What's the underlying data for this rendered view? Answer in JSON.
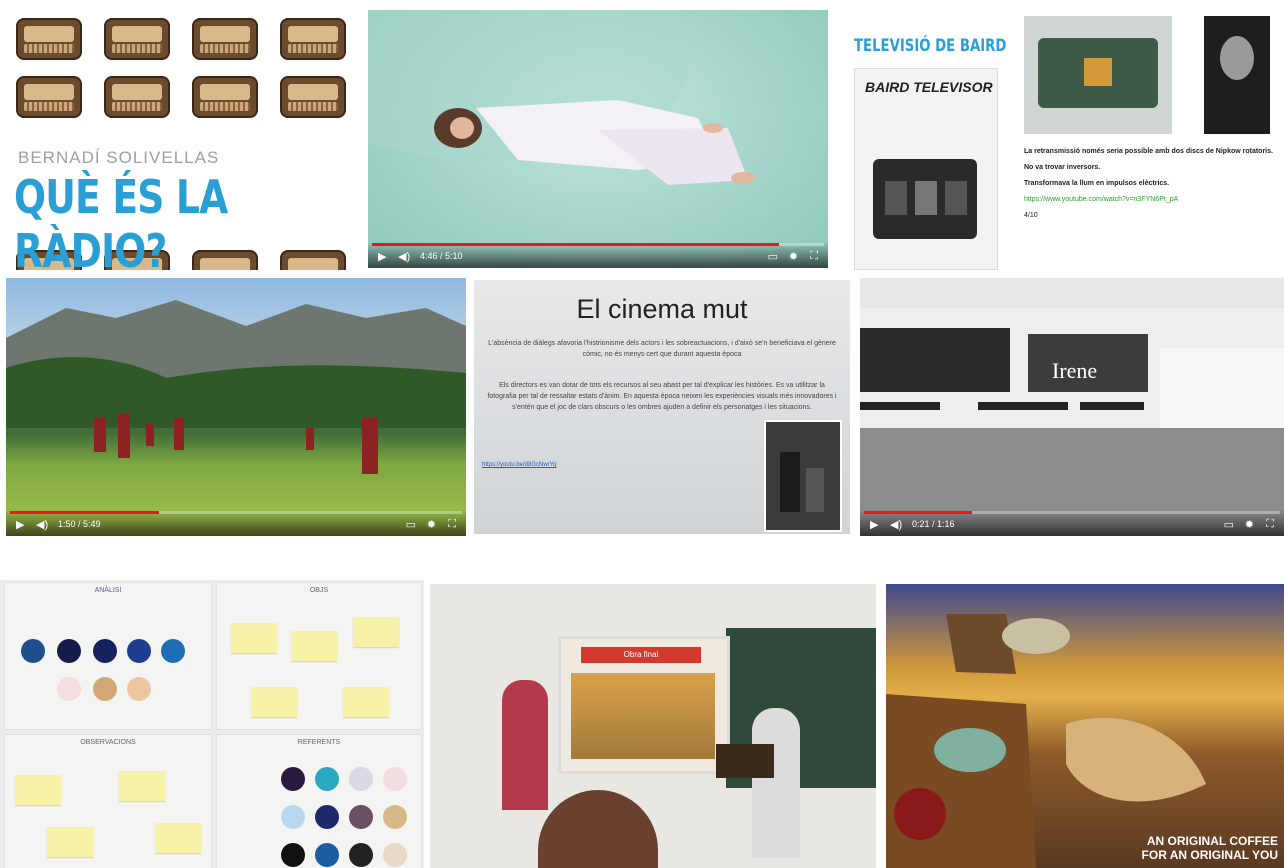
{
  "radio_slide": {
    "author": "BERNADÍ SOLIVELLAS",
    "title": "QUÈ ÉS LA RÀDIO?"
  },
  "video_floating": {
    "time": "4:46 / 5:10",
    "progress": 0.9
  },
  "baird_slide": {
    "title": "TELEVISIÓ DE BAIRD",
    "ad_title": "BAIRD TELEVISOR",
    "line1": "La retransmissió només seria possible amb dos discs de Nipkow rotatoris.",
    "line2": "No va trovar inversors.",
    "line3": "Transformava la llum en impulsos elèctrics.",
    "link": "https://www.youtube.com/watch?v=n3FYN6Pt_pA",
    "number": "4/10"
  },
  "video_meadow": {
    "time": "1:50 / 5:49",
    "progress": 0.33
  },
  "cinema_slide": {
    "title": "El cinema mut",
    "p1": "L'absència de diàlegs afavoria l'histrionisme dels actors i les sobreactuacions, i d'això se'n beneficiava el gènere còmic, no és menys cert que durant aquesta època",
    "p2": "Els directors es van dotar de tots els recursos al seu abast per tal d'explicar les històries. Es va utilitzar la fotografia per tal de ressaltar estats d'ànim. En aquesta època neixen les experiències visuals més innovadores i s'entén que el joc de clars obscurs o les ombres ajuden a definir els personatges i les situacions.",
    "link": "https://youtu.be/d8GcNwrYq"
  },
  "video_irene": {
    "label": "Irene",
    "time": "0:21 / 1:16",
    "progress": 0.26
  },
  "whiteboard": {
    "analisi": "ANÀLISI",
    "objectius": "OBJS",
    "observacions": "OBSERVACIONS",
    "referents": "REFERENTS"
  },
  "classroom": {
    "screen_title": "Obra final"
  },
  "dali_ad": {
    "line1": "AN ORIGINAL COFFEE",
    "line2": "FOR AN ORIGINAL YOU"
  },
  "colors": {
    "accent_blue": "#2a9fd6",
    "video_red": "#e21b1b"
  }
}
